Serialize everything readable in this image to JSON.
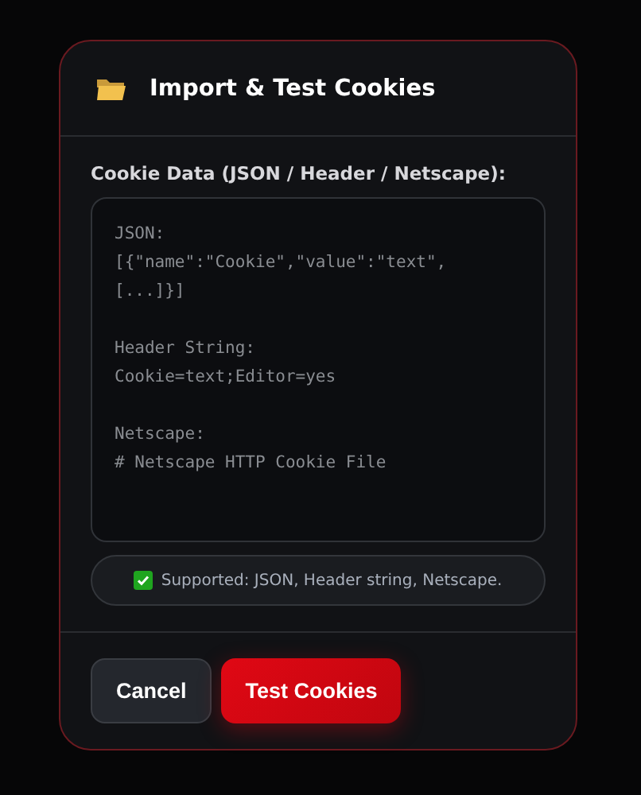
{
  "dialog": {
    "title": "Import & Test Cookies"
  },
  "field": {
    "label": "Cookie Data (JSON / Header / Netscape):",
    "placeholder": "JSON:\n[{\"name\":\"Cookie\",\"value\":\"text\",\n[...]}]\n\nHeader String:\nCookie=text;Editor=yes\n\nNetscape:\n# Netscape HTTP Cookie File"
  },
  "hint": {
    "text": "Supported: JSON, Header string, Netscape."
  },
  "buttons": [
    {
      "label": "Cancel",
      "kind": "secondary"
    },
    {
      "label": "Test Cookies",
      "kind": "primary"
    }
  ]
}
